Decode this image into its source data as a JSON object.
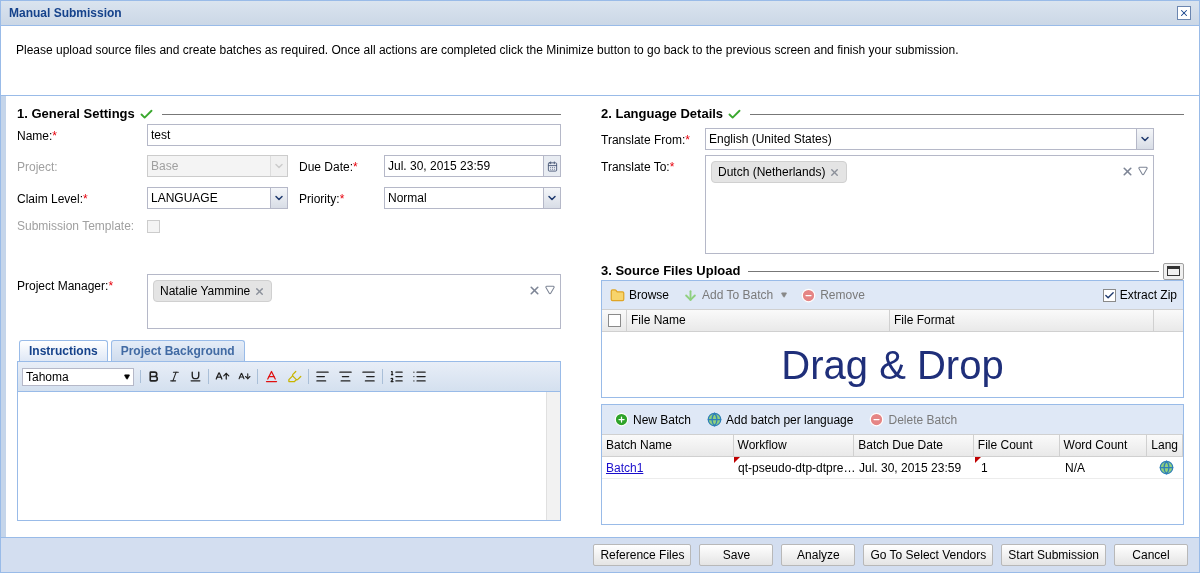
{
  "window": {
    "title": "Manual Submission"
  },
  "intro": "Please upload source files and create batches as required. Once all actions are completed click the Minimize button to go back to the previous screen and finish your submission.",
  "general_settings": {
    "title": "1. General Settings",
    "complete": true,
    "name": {
      "label": "Name:",
      "required_marker": "*",
      "value": "test"
    },
    "project": {
      "label": "Project:",
      "disabled": true,
      "value": "Base"
    },
    "due_date": {
      "label": "Due Date:",
      "required_marker": "*",
      "value": "Jul. 30, 2015 23:59"
    },
    "claim_level": {
      "label": "Claim Level:",
      "required_marker": "*",
      "disabled": false,
      "value": "LANGUAGE"
    },
    "priority": {
      "label": "Priority:",
      "required_marker": "*",
      "disabled": false,
      "value": "Normal"
    },
    "submission_template": {
      "label": "Submission Template:",
      "disabled": true,
      "checked": false
    },
    "project_manager": {
      "label": "Project Manager:",
      "required_marker": "*",
      "tags": [
        "Natalie Yammine"
      ]
    }
  },
  "editor": {
    "tabs": [
      {
        "label": "Instructions",
        "selected": true
      },
      {
        "label": "Project Background",
        "selected": false
      }
    ],
    "font": "Tahoma"
  },
  "language_details": {
    "title": "2. Language Details",
    "complete": true,
    "translate_from": {
      "label": "Translate From:",
      "required_marker": "*",
      "disabled": false,
      "value": "English (United States)"
    },
    "translate_to": {
      "label": "Translate To:",
      "required_marker": "*",
      "tags": [
        "Dutch (Netherlands)"
      ]
    }
  },
  "source_files": {
    "title": "3. Source Files Upload",
    "toolbar": [
      {
        "kind": "browse",
        "label": "Browse",
        "disabled": false
      },
      {
        "kind": "add",
        "label": "Add To Batch",
        "disabled": true
      },
      {
        "kind": "remove",
        "label": "Remove",
        "disabled": true
      }
    ],
    "extract_zip": {
      "label": "Extract Zip",
      "checked": true
    },
    "select_all": {
      "checked": false
    },
    "columns": [
      "File Name",
      "File Format"
    ],
    "drop_text": "Drag & Drop"
  },
  "batches": {
    "toolbar": [
      {
        "kind": "new",
        "label": "New Batch",
        "disabled": false
      },
      {
        "kind": "globe",
        "label": "Add batch per language",
        "disabled": false
      },
      {
        "kind": "delete",
        "label": "Delete Batch",
        "disabled": true
      }
    ],
    "columns": [
      "Batch Name",
      "Workflow",
      "Batch Due Date",
      "File Count",
      "Word Count",
      "Lang"
    ],
    "rows": [
      {
        "batch_name": "Batch1",
        "workflow": "qt-pseudo-dtp-dtpre…",
        "workflow_modified": true,
        "due_date": "Jul. 30, 2015 23:59",
        "file_count": "1",
        "file_count_modified": true,
        "word_count": "N/A"
      }
    ]
  },
  "buttons": [
    "Reference Files",
    "Save",
    "Analyze",
    "Go To Select Vendors",
    "Start Submission",
    "Cancel"
  ]
}
